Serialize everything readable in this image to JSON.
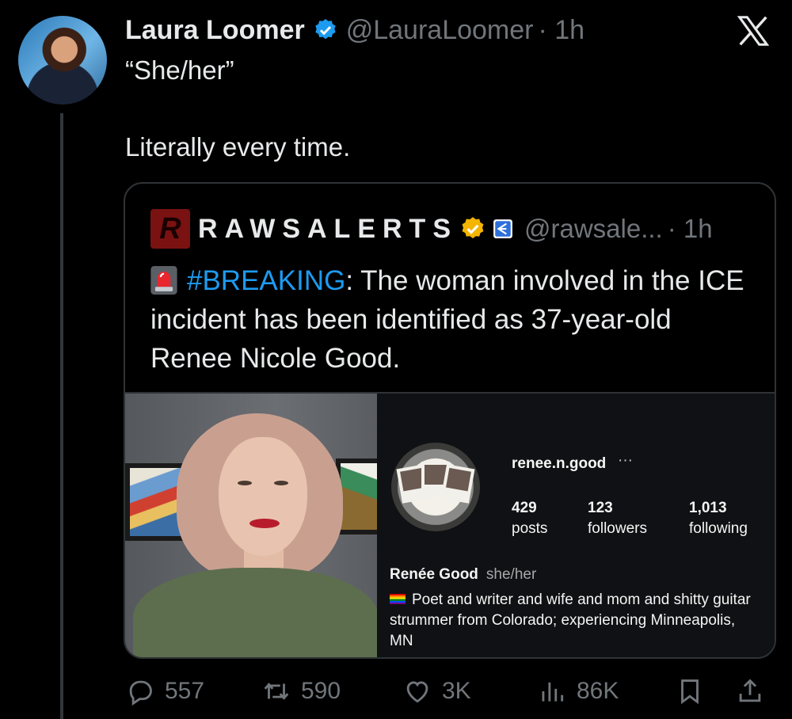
{
  "tweet": {
    "author_name": "Laura Loomer",
    "author_handle": "@LauraLoomer",
    "time": "· 1h",
    "text_line1": "“She/her”",
    "text_line2": "Literally every time."
  },
  "quoted_tweet": {
    "author_name": "RAWSALERTS",
    "author_handle": "@rawsale...",
    "time": "· 1h",
    "hashtag": "#BREAKING",
    "text": ": The woman involved in the ICE incident has been identified as 37-year-old Renee Nicole Good."
  },
  "instagram_profile": {
    "username": "renee.n.good",
    "more": "···",
    "stats": [
      {
        "value": "429",
        "label": "posts"
      },
      {
        "value": "123",
        "label": "followers"
      },
      {
        "value": "1,013",
        "label": "following"
      }
    ],
    "display_name": "Renée Good",
    "pronouns": "she/her",
    "bio": "Poet and writer and wife and mom and shitty guitar strummer from Colorado; experiencing Minneapolis, MN"
  },
  "actions": {
    "replies": "557",
    "reposts": "590",
    "likes": "3K",
    "views": "86K"
  },
  "colors": {
    "background": "#000000",
    "text": "#e7e9ea",
    "muted": "#71767b",
    "link": "#1d9bf0",
    "verified": "#1d9bf0",
    "gold_badge": "#f4b400"
  },
  "icons": [
    "x-logo-icon",
    "verified-badge-icon",
    "gold-badge-icon",
    "affiliate-badge-icon",
    "siren-icon",
    "reply-icon",
    "repost-icon",
    "like-icon",
    "views-icon",
    "bookmark-icon",
    "share-icon"
  ]
}
